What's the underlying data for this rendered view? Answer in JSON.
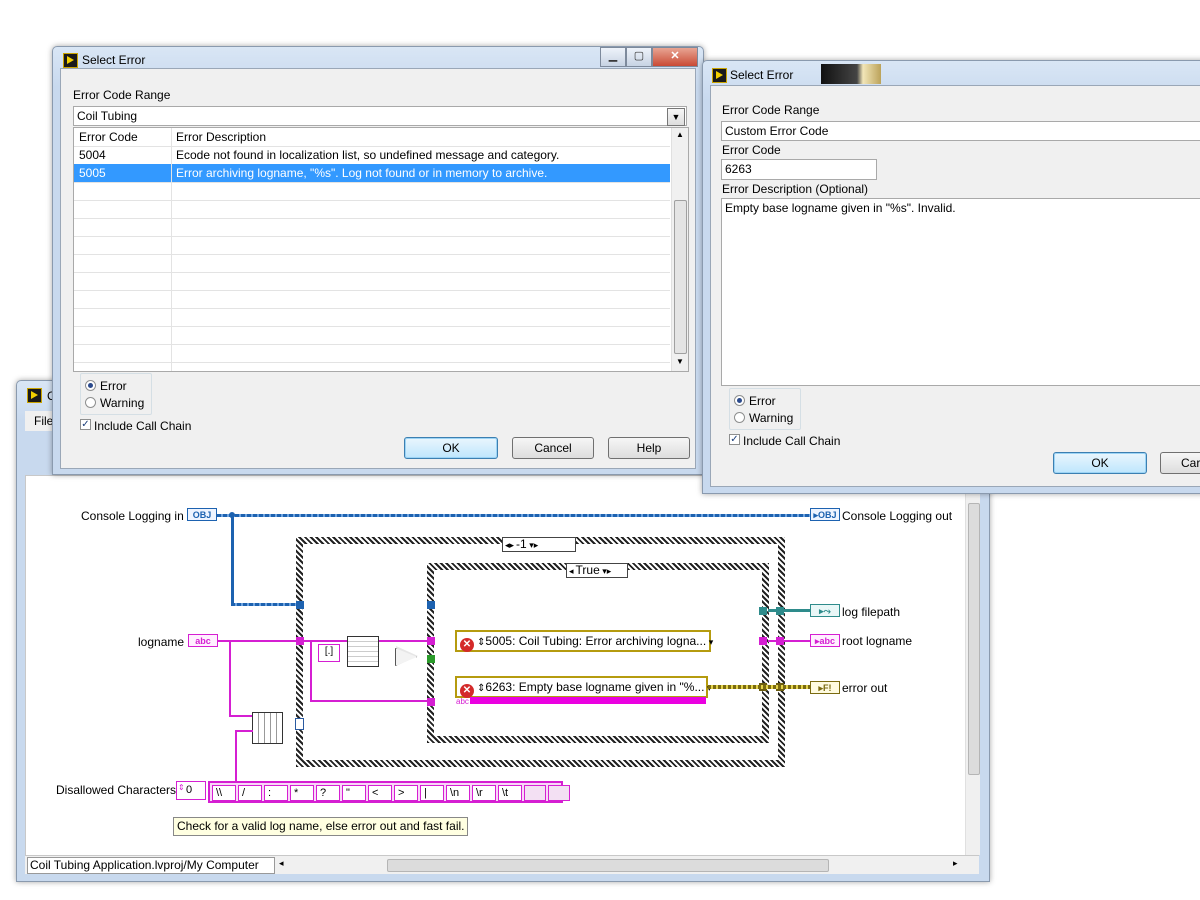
{
  "dialog1": {
    "title": "Select Error",
    "range_label": "Error Code Range",
    "range_value": "Coil Tubing",
    "columns": [
      "Error Code",
      "Error Description"
    ],
    "rows": [
      {
        "code": "5004",
        "desc": "Ecode not found in localization list, so undefined message and category."
      },
      {
        "code": "5005",
        "desc": "Error archiving logname, \"%s\".  Log not found or in memory to archive."
      }
    ],
    "selected_row": 1,
    "radio_error": "Error",
    "radio_warning": "Warning",
    "include_call_chain": "Include Call Chain",
    "ok": "OK",
    "cancel": "Cancel",
    "help": "Help"
  },
  "dialog2": {
    "title": "Select Error",
    "range_label": "Error Code Range",
    "range_value": "Custom Error Code",
    "code_label": "Error Code",
    "code_value": "6263",
    "desc_label": "Error Description (Optional)",
    "desc_value": "Empty base logname given in \"%s\". Invalid.",
    "radio_error": "Error",
    "radio_warning": "Warning",
    "include_call_chain": "Include Call Chain",
    "ok": "OK",
    "cancel": "Car"
  },
  "main_window": {
    "title_fragment": "C",
    "menu_file": "File",
    "status_path": "Coil Tubing Application.lvproj/My Computer",
    "block_diagram": {
      "console_in": "Console Logging in",
      "console_out": "Console Logging out",
      "logname": "logname",
      "log_filepath": "log filepath",
      "root_logname": "root logname",
      "error_out": "error out",
      "disallowed": "Disallowed Characters",
      "array_index": "0",
      "array_items": [
        "\\\\",
        "/",
        ":",
        "*",
        "?",
        "\"",
        "<",
        ">",
        "|",
        "\\n",
        "\\r",
        "\\t"
      ],
      "outer_case": "-1",
      "inner_case": "True",
      "err1": "5005: Coil Tubing: Error archiving logna...",
      "err2": "6263: Empty base logname given in \"%...",
      "comment": "Check for a valid log name, else error out and fast fail.",
      "obj_tag": "OBJ",
      "abc_tag": "abc",
      "bracket_const": "[.]"
    }
  },
  "colors": {
    "selection": "#3399ff",
    "string_wire": "#d51fd2",
    "class_wire": "#1d62b0",
    "error_wire": "#7a6a10",
    "comment_bg": "#ffffe1"
  }
}
